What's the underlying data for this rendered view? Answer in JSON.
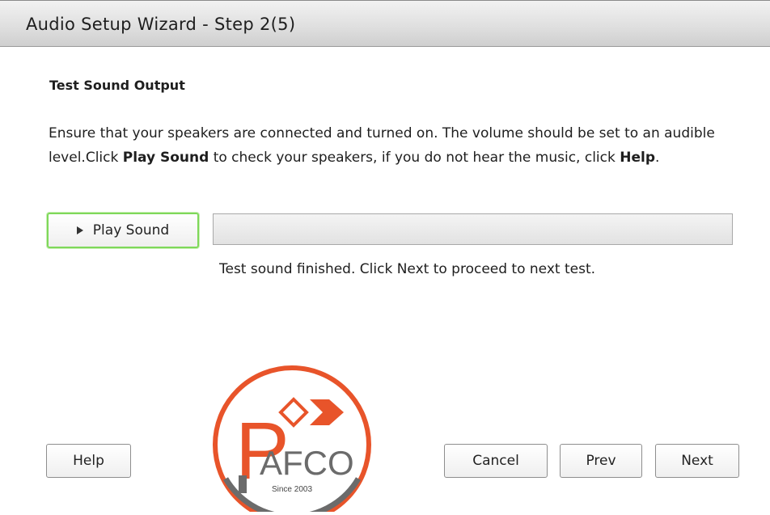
{
  "window": {
    "title": "Audio Setup Wizard - Step 2(5)"
  },
  "section": {
    "title": "Test Sound Output"
  },
  "description": {
    "part1": "Ensure that your speakers are connected and turned on. The volume should be set to an audible level.Click ",
    "bold1": "Play Sound",
    "part2": " to check your speakers, if you do not hear the music, click ",
    "bold2": "Help",
    "part3": "."
  },
  "play_button": {
    "label": "Play Sound",
    "icon": "play-triangle-icon"
  },
  "progress": {
    "fraction": 0
  },
  "status": {
    "text": "Test sound finished. Click Next to proceed to next test."
  },
  "logo": {
    "text": "AFCO",
    "tagline": "Since 2003",
    "letter": "P",
    "colors": {
      "orange": "#e8542a",
      "gray": "#6b6b6b"
    }
  },
  "footer": {
    "help_label": "Help",
    "cancel_label": "Cancel",
    "prev_label": "Prev",
    "next_label": "Next"
  },
  "colors": {
    "focus_outline": "#7fd85a",
    "titlebar": "#dcdcdc"
  }
}
